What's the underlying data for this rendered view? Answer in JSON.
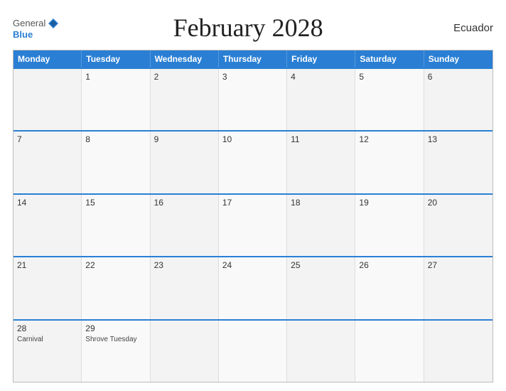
{
  "header": {
    "title": "February 2028",
    "country": "Ecuador",
    "logo": {
      "general": "General",
      "blue": "Blue"
    }
  },
  "days_of_week": [
    "Monday",
    "Tuesday",
    "Wednesday",
    "Thursday",
    "Friday",
    "Saturday",
    "Sunday"
  ],
  "weeks": [
    [
      {
        "day": "",
        "event": ""
      },
      {
        "day": "1",
        "event": ""
      },
      {
        "day": "2",
        "event": ""
      },
      {
        "day": "3",
        "event": ""
      },
      {
        "day": "4",
        "event": ""
      },
      {
        "day": "5",
        "event": ""
      },
      {
        "day": "6",
        "event": ""
      }
    ],
    [
      {
        "day": "7",
        "event": ""
      },
      {
        "day": "8",
        "event": ""
      },
      {
        "day": "9",
        "event": ""
      },
      {
        "day": "10",
        "event": ""
      },
      {
        "day": "11",
        "event": ""
      },
      {
        "day": "12",
        "event": ""
      },
      {
        "day": "13",
        "event": ""
      }
    ],
    [
      {
        "day": "14",
        "event": ""
      },
      {
        "day": "15",
        "event": ""
      },
      {
        "day": "16",
        "event": ""
      },
      {
        "day": "17",
        "event": ""
      },
      {
        "day": "18",
        "event": ""
      },
      {
        "day": "19",
        "event": ""
      },
      {
        "day": "20",
        "event": ""
      }
    ],
    [
      {
        "day": "21",
        "event": ""
      },
      {
        "day": "22",
        "event": ""
      },
      {
        "day": "23",
        "event": ""
      },
      {
        "day": "24",
        "event": ""
      },
      {
        "day": "25",
        "event": ""
      },
      {
        "day": "26",
        "event": ""
      },
      {
        "day": "27",
        "event": ""
      }
    ],
    [
      {
        "day": "28",
        "event": "Carnival"
      },
      {
        "day": "29",
        "event": "Shrove Tuesday"
      },
      {
        "day": "",
        "event": ""
      },
      {
        "day": "",
        "event": ""
      },
      {
        "day": "",
        "event": ""
      },
      {
        "day": "",
        "event": ""
      },
      {
        "day": "",
        "event": ""
      }
    ]
  ]
}
